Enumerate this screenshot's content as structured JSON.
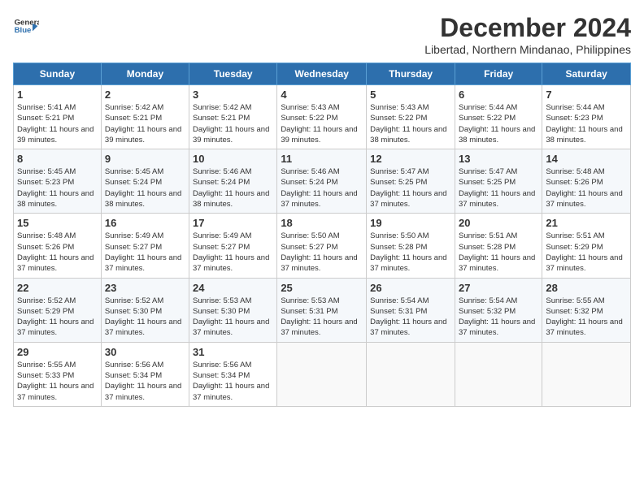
{
  "header": {
    "logo_line1": "General",
    "logo_line2": "Blue",
    "month": "December 2024",
    "location": "Libertad, Northern Mindanao, Philippines"
  },
  "weekdays": [
    "Sunday",
    "Monday",
    "Tuesday",
    "Wednesday",
    "Thursday",
    "Friday",
    "Saturday"
  ],
  "weeks": [
    [
      {
        "day": "1",
        "sunrise": "5:41 AM",
        "sunset": "5:21 PM",
        "daylight": "11 hours and 39 minutes."
      },
      {
        "day": "2",
        "sunrise": "5:42 AM",
        "sunset": "5:21 PM",
        "daylight": "11 hours and 39 minutes."
      },
      {
        "day": "3",
        "sunrise": "5:42 AM",
        "sunset": "5:21 PM",
        "daylight": "11 hours and 39 minutes."
      },
      {
        "day": "4",
        "sunrise": "5:43 AM",
        "sunset": "5:22 PM",
        "daylight": "11 hours and 39 minutes."
      },
      {
        "day": "5",
        "sunrise": "5:43 AM",
        "sunset": "5:22 PM",
        "daylight": "11 hours and 38 minutes."
      },
      {
        "day": "6",
        "sunrise": "5:44 AM",
        "sunset": "5:22 PM",
        "daylight": "11 hours and 38 minutes."
      },
      {
        "day": "7",
        "sunrise": "5:44 AM",
        "sunset": "5:23 PM",
        "daylight": "11 hours and 38 minutes."
      }
    ],
    [
      {
        "day": "8",
        "sunrise": "5:45 AM",
        "sunset": "5:23 PM",
        "daylight": "11 hours and 38 minutes."
      },
      {
        "day": "9",
        "sunrise": "5:45 AM",
        "sunset": "5:24 PM",
        "daylight": "11 hours and 38 minutes."
      },
      {
        "day": "10",
        "sunrise": "5:46 AM",
        "sunset": "5:24 PM",
        "daylight": "11 hours and 38 minutes."
      },
      {
        "day": "11",
        "sunrise": "5:46 AM",
        "sunset": "5:24 PM",
        "daylight": "11 hours and 37 minutes."
      },
      {
        "day": "12",
        "sunrise": "5:47 AM",
        "sunset": "5:25 PM",
        "daylight": "11 hours and 37 minutes."
      },
      {
        "day": "13",
        "sunrise": "5:47 AM",
        "sunset": "5:25 PM",
        "daylight": "11 hours and 37 minutes."
      },
      {
        "day": "14",
        "sunrise": "5:48 AM",
        "sunset": "5:26 PM",
        "daylight": "11 hours and 37 minutes."
      }
    ],
    [
      {
        "day": "15",
        "sunrise": "5:48 AM",
        "sunset": "5:26 PM",
        "daylight": "11 hours and 37 minutes."
      },
      {
        "day": "16",
        "sunrise": "5:49 AM",
        "sunset": "5:27 PM",
        "daylight": "11 hours and 37 minutes."
      },
      {
        "day": "17",
        "sunrise": "5:49 AM",
        "sunset": "5:27 PM",
        "daylight": "11 hours and 37 minutes."
      },
      {
        "day": "18",
        "sunrise": "5:50 AM",
        "sunset": "5:27 PM",
        "daylight": "11 hours and 37 minutes."
      },
      {
        "day": "19",
        "sunrise": "5:50 AM",
        "sunset": "5:28 PM",
        "daylight": "11 hours and 37 minutes."
      },
      {
        "day": "20",
        "sunrise": "5:51 AM",
        "sunset": "5:28 PM",
        "daylight": "11 hours and 37 minutes."
      },
      {
        "day": "21",
        "sunrise": "5:51 AM",
        "sunset": "5:29 PM",
        "daylight": "11 hours and 37 minutes."
      }
    ],
    [
      {
        "day": "22",
        "sunrise": "5:52 AM",
        "sunset": "5:29 PM",
        "daylight": "11 hours and 37 minutes."
      },
      {
        "day": "23",
        "sunrise": "5:52 AM",
        "sunset": "5:30 PM",
        "daylight": "11 hours and 37 minutes."
      },
      {
        "day": "24",
        "sunrise": "5:53 AM",
        "sunset": "5:30 PM",
        "daylight": "11 hours and 37 minutes."
      },
      {
        "day": "25",
        "sunrise": "5:53 AM",
        "sunset": "5:31 PM",
        "daylight": "11 hours and 37 minutes."
      },
      {
        "day": "26",
        "sunrise": "5:54 AM",
        "sunset": "5:31 PM",
        "daylight": "11 hours and 37 minutes."
      },
      {
        "day": "27",
        "sunrise": "5:54 AM",
        "sunset": "5:32 PM",
        "daylight": "11 hours and 37 minutes."
      },
      {
        "day": "28",
        "sunrise": "5:55 AM",
        "sunset": "5:32 PM",
        "daylight": "11 hours and 37 minutes."
      }
    ],
    [
      {
        "day": "29",
        "sunrise": "5:55 AM",
        "sunset": "5:33 PM",
        "daylight": "11 hours and 37 minutes."
      },
      {
        "day": "30",
        "sunrise": "5:56 AM",
        "sunset": "5:34 PM",
        "daylight": "11 hours and 37 minutes."
      },
      {
        "day": "31",
        "sunrise": "5:56 AM",
        "sunset": "5:34 PM",
        "daylight": "11 hours and 37 minutes."
      },
      null,
      null,
      null,
      null
    ]
  ]
}
